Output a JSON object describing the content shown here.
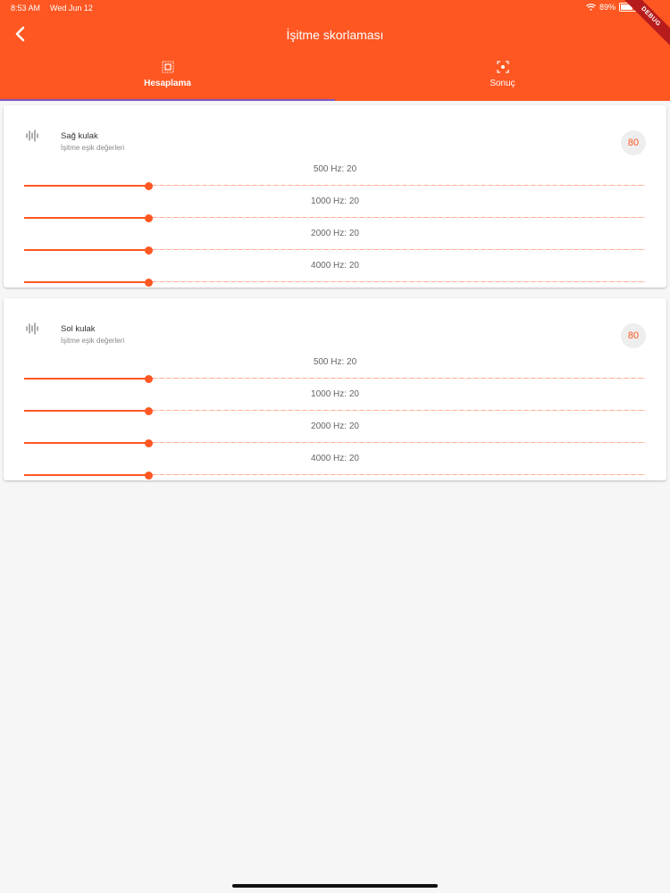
{
  "status_bar": {
    "time": "8:53 AM",
    "date": "Wed Jun 12",
    "battery": "89%"
  },
  "debug_banner": "DEBUG",
  "app_bar": {
    "title": "İşitme skorlaması",
    "back_icon": "chevron-left-icon"
  },
  "tabs": [
    {
      "label": "Hesaplama",
      "icon": "select-frame-icon",
      "active": true
    },
    {
      "label": "Sonuç",
      "icon": "focus-frame-icon",
      "active": false
    }
  ],
  "colors": {
    "primary": "#ff5722",
    "tab_indicator": "#7e57c2",
    "background": "#f6f6f6"
  },
  "cards": [
    {
      "title": "Sağ kulak",
      "subtitle": "İşitme eşik değerleri",
      "score": "80",
      "icon": "audio-wave-icon",
      "sliders": [
        {
          "label": "500 Hz: 20",
          "value": 20,
          "min": 0,
          "max": 100
        },
        {
          "label": "1000 Hz: 20",
          "value": 20,
          "min": 0,
          "max": 100
        },
        {
          "label": "2000 Hz: 20",
          "value": 20,
          "min": 0,
          "max": 100
        },
        {
          "label": "4000 Hz: 20",
          "value": 20,
          "min": 0,
          "max": 100
        }
      ]
    },
    {
      "title": "Sol kulak",
      "subtitle": "İşitme eşik değerleri",
      "score": "80",
      "icon": "audio-wave-icon",
      "sliders": [
        {
          "label": "500 Hz: 20",
          "value": 20,
          "min": 0,
          "max": 100
        },
        {
          "label": "1000 Hz: 20",
          "value": 20,
          "min": 0,
          "max": 100
        },
        {
          "label": "2000 Hz: 20",
          "value": 20,
          "min": 0,
          "max": 100
        },
        {
          "label": "4000 Hz: 20",
          "value": 20,
          "min": 0,
          "max": 100
        }
      ]
    }
  ]
}
